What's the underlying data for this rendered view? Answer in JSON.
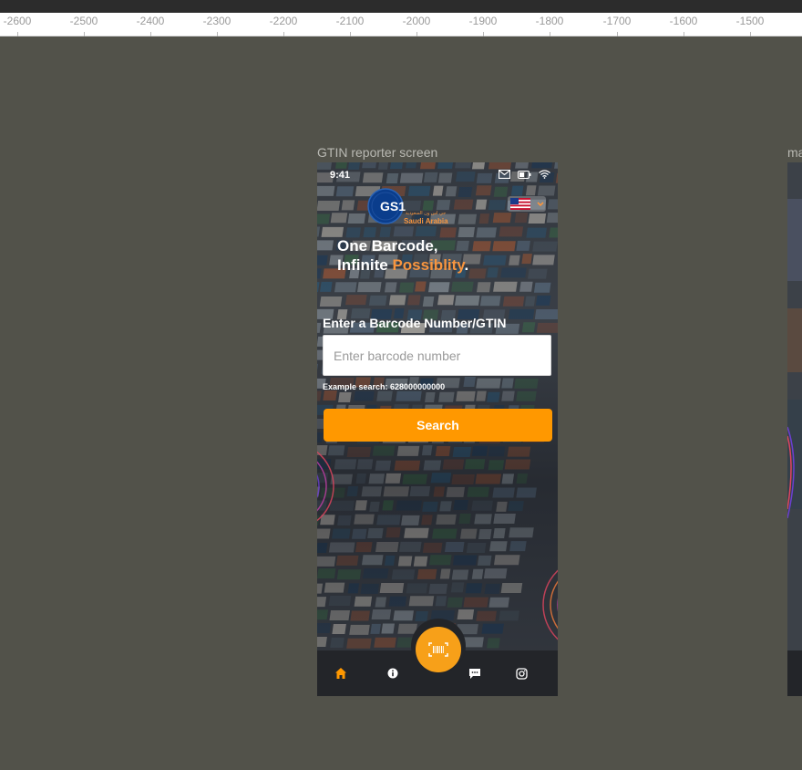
{
  "ruler": {
    "ticks": [
      "-2600",
      "-2500",
      "-2400",
      "-2300",
      "-2200",
      "-2100",
      "-2000",
      "-1900",
      "-1800",
      "-1700",
      "-1600",
      "-1500"
    ]
  },
  "frames": {
    "main_label": "GTIN reporter screen",
    "second_label": "ma"
  },
  "phone": {
    "status_time": "9:41",
    "status_icons": [
      "mail-icon",
      "battery-icon",
      "wifi-icon"
    ],
    "logo": {
      "brand": "GS1",
      "subtitle": "Saudi Arabia",
      "arabic": "جي اس ون السعودية"
    },
    "language": "us-flag-icon",
    "headline_line1": "One Barcode,",
    "headline_line2_prefix": "Infinite ",
    "headline_line2_accent": "Possiblity",
    "headline_line2_suffix": ".",
    "input_label": "Enter a Barcode Number/GTIN",
    "input_placeholder": "Enter barcode number",
    "input_value": "",
    "example_text": "Example search: 628000000000",
    "search_label": "Search",
    "nav": [
      "home-icon",
      "info-icon",
      "barcode-scan-icon",
      "chat-icon",
      "instagram-icon"
    ]
  },
  "colors": {
    "accent": "#ff9800",
    "fab": "#f7a019",
    "headline_accent": "#f7953f",
    "canvas": "#52524a",
    "navbar": "#232529"
  }
}
